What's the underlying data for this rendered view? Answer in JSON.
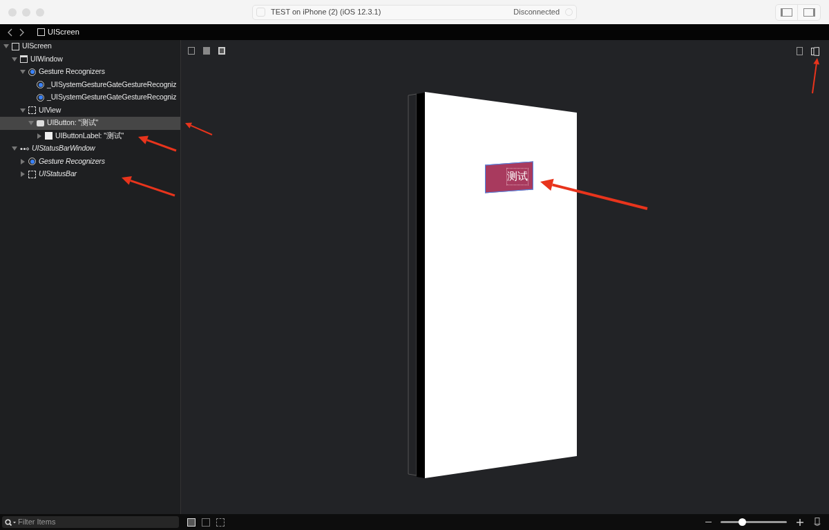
{
  "window": {
    "scheme_field": {
      "target": "TEST on iPhone (2) (iOS 12.3.1)",
      "status": "Disconnected"
    }
  },
  "breadcrumb": {
    "label": "UIScreen"
  },
  "tree": [
    {
      "label": "UIScreen",
      "kind": "screen",
      "italic": false,
      "expanded": true,
      "selected": false,
      "children": [
        {
          "label": "UIWindow",
          "kind": "window",
          "italic": false,
          "expanded": true,
          "selected": false,
          "children": [
            {
              "label": "Gesture Recognizers",
              "kind": "gesture",
              "italic": false,
              "expanded": true,
              "selected": false,
              "children": [
                {
                  "label": "_UISystemGestureGateGestureRecogniz",
                  "kind": "gesture",
                  "italic": false,
                  "selected": false
                },
                {
                  "label": "_UISystemGestureGateGestureRecogniz",
                  "kind": "gesture",
                  "italic": false,
                  "selected": false
                }
              ]
            },
            {
              "label": "UIView",
              "kind": "view",
              "italic": false,
              "expanded": true,
              "selected": false,
              "children": [
                {
                  "label": "UIButton: \"测试\"",
                  "kind": "button",
                  "italic": false,
                  "expanded": true,
                  "selected": true,
                  "children": [
                    {
                      "label": "UIButtonLabel: \"测试\"",
                      "kind": "label",
                      "italic": false,
                      "expanded": false,
                      "selected": false
                    }
                  ]
                }
              ]
            }
          ]
        },
        {
          "label": "UIStatusBarWindow",
          "kind": "dots",
          "italic": true,
          "expanded": true,
          "selected": false,
          "children": [
            {
              "label": "Gesture Recognizers",
              "kind": "gesture",
              "italic": true,
              "expanded": false,
              "selected": false
            },
            {
              "label": "UIStatusBar",
              "kind": "view",
              "italic": true,
              "expanded": false,
              "selected": false
            }
          ]
        }
      ]
    }
  ],
  "canvas": {
    "button_label": "测试"
  },
  "filter": {
    "placeholder": "Filter Items"
  },
  "zoom": {
    "level": 0.32
  }
}
